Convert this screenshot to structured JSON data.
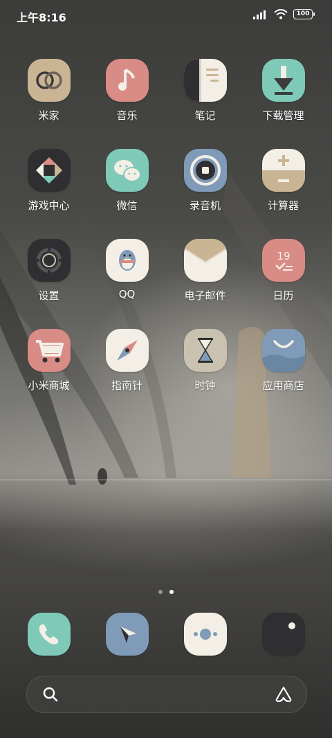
{
  "status": {
    "time": "上午8:16",
    "battery": "100"
  },
  "apps": [
    {
      "label": "米家",
      "icon": "mijia-rings-icon",
      "bg": "#c9b594"
    },
    {
      "label": "音乐",
      "icon": "music-note-icon",
      "bg": "#d98b86"
    },
    {
      "label": "笔记",
      "icon": "notes-icon",
      "bg": "#f3efe6"
    },
    {
      "label": "下载管理",
      "icon": "download-arrow-icon",
      "bg": "#7ec9b8"
    },
    {
      "label": "游戏中心",
      "icon": "game-diamond-icon",
      "bg": "#2f2f31"
    },
    {
      "label": "微信",
      "icon": "wechat-bubbles-icon",
      "bg": "#7ec9b8"
    },
    {
      "label": "录音机",
      "icon": "recorder-icon",
      "bg": "#7f9bb8"
    },
    {
      "label": "计算器",
      "icon": "calculator-icon",
      "bg": "#f3efe6"
    },
    {
      "label": "设置",
      "icon": "settings-gear-icon",
      "bg": "#2f2f31"
    },
    {
      "label": "QQ",
      "icon": "qq-penguin-icon",
      "bg": "#f3efe6"
    },
    {
      "label": "电子邮件",
      "icon": "email-envelope-icon",
      "bg": "#f3efe6"
    },
    {
      "label": "日历",
      "icon": "calendar-icon",
      "bg": "#d98b86",
      "day": "19"
    },
    {
      "label": "小米商城",
      "icon": "shopping-cart-icon",
      "bg": "#d98b86"
    },
    {
      "label": "指南针",
      "icon": "compass-icon",
      "bg": "#f3efe6"
    },
    {
      "label": "时钟",
      "icon": "hourglass-clock-icon",
      "bg": "#c9c2b0"
    },
    {
      "label": "应用商店",
      "icon": "app-store-bag-icon",
      "bg": "#7f9bb8"
    }
  ],
  "dock": [
    {
      "icon": "phone-icon",
      "bg": "#7ec9b8"
    },
    {
      "icon": "navigation-arrow-icon",
      "bg": "#7f9bb8"
    },
    {
      "icon": "camera-dots-icon",
      "bg": "#f3efe6"
    },
    {
      "icon": "camera-lens-icon",
      "bg": "#2f2f31"
    }
  ],
  "pages": {
    "count": 2,
    "active_index": 1
  },
  "search": {
    "icon": "search-icon",
    "assistant_icon": "assistant-icon"
  }
}
